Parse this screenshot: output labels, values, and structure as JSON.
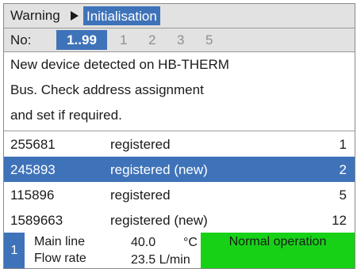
{
  "header": {
    "crumb_parent": "Warning",
    "crumb_current": "Initialisation"
  },
  "nav": {
    "label": "No:",
    "selected_range": "1..99",
    "pages": [
      "1",
      "2",
      "3",
      "5"
    ]
  },
  "message": {
    "lines": [
      "New device detected on HB-THERM",
      "Bus. Check address assignment",
      "and set if required."
    ]
  },
  "devices": [
    {
      "id": "255681",
      "status": "registered",
      "address": "1",
      "selected": false
    },
    {
      "id": "245893",
      "status": "registered (new)",
      "address": "2",
      "selected": true
    },
    {
      "id": "115896",
      "status": "registered",
      "address": "5",
      "selected": false
    },
    {
      "id": "1589663",
      "status": "registered (new)",
      "address": "12",
      "selected": false
    }
  ],
  "statusbar": {
    "index": "1",
    "label1": "Main line",
    "label2": "Flow rate",
    "value1": "40.0",
    "unit1": "°C",
    "value2": "23.5 L/min",
    "operation": "Normal operation"
  },
  "colors": {
    "selection": "#3f73b9",
    "header_bg": "#e2e2e2",
    "ok_status": "#17d117"
  }
}
